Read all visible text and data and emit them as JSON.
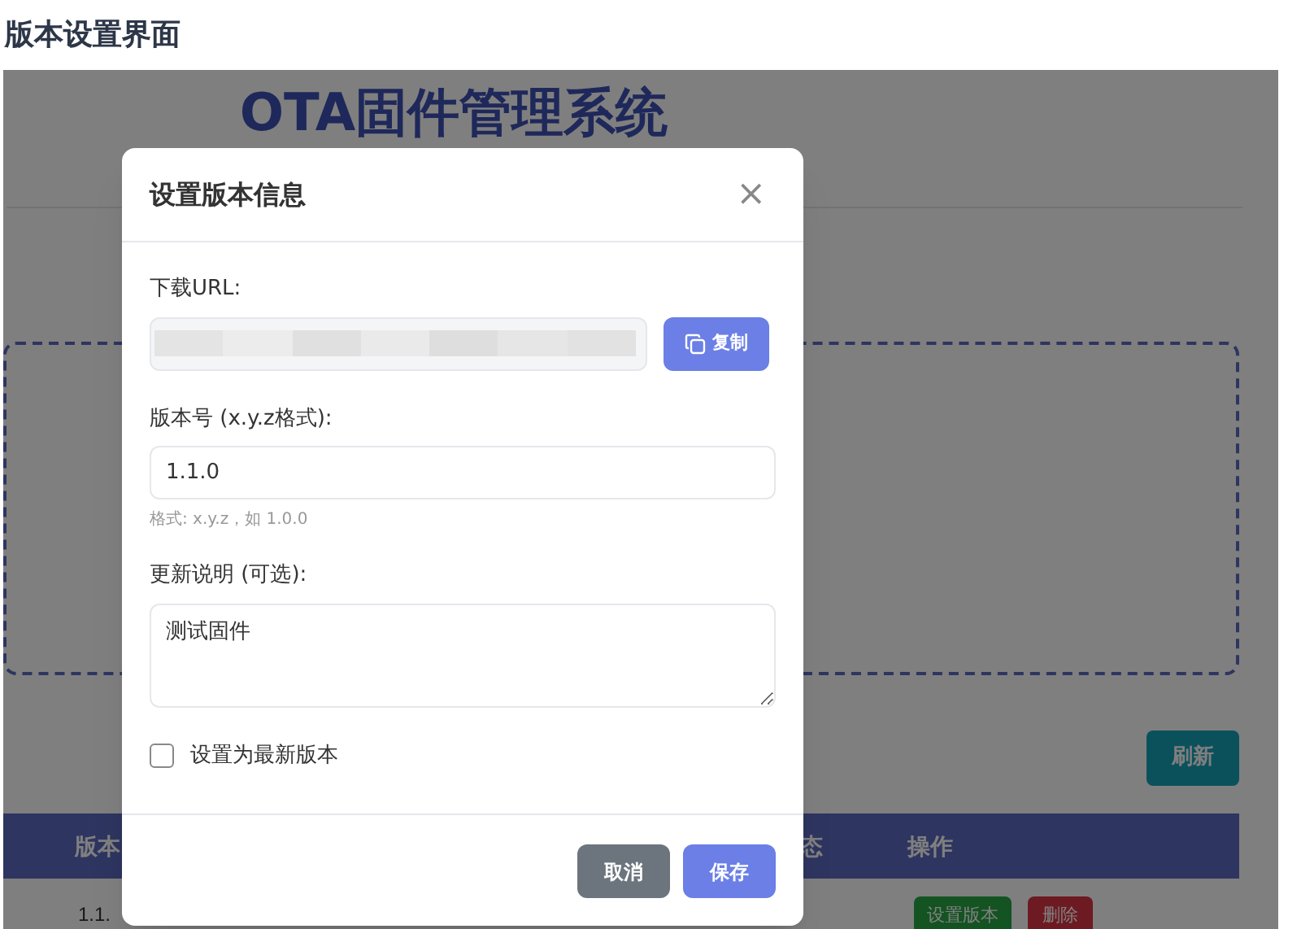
{
  "page_heading": "版本设置界面",
  "background": {
    "title": "OTA固件管理系统",
    "refresh_button": "刷新",
    "table": {
      "columns": [
        "版本",
        "态",
        "操作"
      ],
      "rows": [
        {
          "version": "1.1.",
          "actions": [
            "设置版本",
            "删除"
          ]
        }
      ]
    }
  },
  "dialog": {
    "title": "设置版本信息",
    "close": "×",
    "url_label": "下载URL:",
    "copy_button": "复制",
    "version_label": "版本号 (x.y.z格式):",
    "version_value": "1.1.0",
    "version_hint": "格式: x.y.z，如 1.0.0",
    "notes_label": "更新说明 (可选):",
    "notes_value": "测试固件",
    "latest": {
      "label": "设置为最新版本",
      "checked": false
    },
    "buttons": [
      {
        "label": "取消",
        "kind": "secondary"
      },
      {
        "label": "保存",
        "kind": "primary"
      }
    ]
  }
}
